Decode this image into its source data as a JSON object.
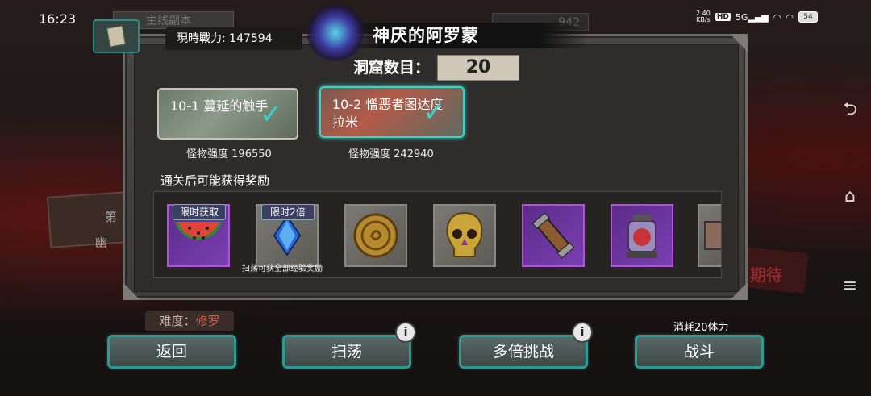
{
  "status_bar": {
    "time": "16:23",
    "net_speed": "2.40",
    "net_unit": "KB/s",
    "hd": "HD",
    "signal": "5G",
    "battery": "54"
  },
  "background": {
    "mode_tab": "主线副本",
    "counter": "942",
    "difficulty_label": "难度：",
    "difficulty_value": "修罗",
    "left_text_1": "第",
    "left_text_2": "幽",
    "right_text": "期待"
  },
  "header": {
    "power_label": "現時戰力:",
    "power_value": "147594",
    "title": "神厌的阿罗蒙"
  },
  "cave": {
    "label": "洞窟数目：",
    "value": "20"
  },
  "stages": [
    {
      "name": "10-1 蔓延的触手",
      "monster_label": "怪物强度",
      "monster_value": "196550",
      "cleared": true
    },
    {
      "name": "10-2 憎恶者图达度拉米",
      "monster_label": "怪物强度",
      "monster_value": "242940",
      "cleared": true
    }
  ],
  "rewards": {
    "label": "通关后可能获得奖励",
    "items": [
      {
        "icon": "watermelon-icon",
        "tag": "限时获取",
        "rarity": "purple"
      },
      {
        "icon": "blue-crystal-icon",
        "tag": "限时2倍",
        "rarity": "gray",
        "note": "扫荡可获全部经验奖励"
      },
      {
        "icon": "coin-icon",
        "rarity": "gray"
      },
      {
        "icon": "golden-skull-icon",
        "rarity": "gray"
      },
      {
        "icon": "vial-icon",
        "rarity": "purple"
      },
      {
        "icon": "jar-icon",
        "rarity": "purple"
      },
      {
        "icon": "partial-item-icon",
        "rarity": "gray"
      }
    ]
  },
  "buttons": {
    "back": "返回",
    "sweep": "扫荡",
    "multi": "多倍挑战",
    "fight": "战斗",
    "fight_cost": "消耗20体力",
    "info": "i"
  },
  "colors": {
    "accent": "#2a9c96",
    "check": "#38d2c6",
    "rare": "#b350d8"
  }
}
